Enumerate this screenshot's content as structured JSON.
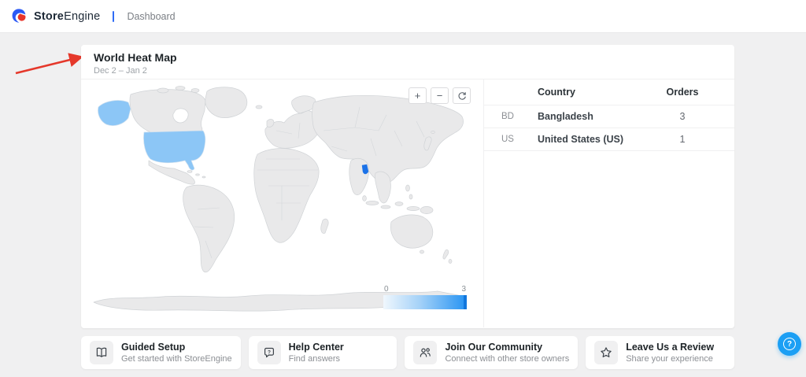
{
  "header": {
    "brand_bold": "Store",
    "brand_light": "Engine",
    "nav": "Dashboard"
  },
  "heatmap": {
    "title": "World Heat Map",
    "date_range": "Dec 2 – Jan 2",
    "controls": {
      "zoom_in": "+",
      "zoom_out": "−"
    },
    "legend": {
      "min": "0",
      "max": "3"
    },
    "table": {
      "header": {
        "country": "Country",
        "orders": "Orders"
      },
      "rows": [
        {
          "code": "BD",
          "country": "Bangladesh",
          "orders": "3"
        },
        {
          "code": "US",
          "country": "United States (US)",
          "orders": "1"
        }
      ]
    }
  },
  "chart_data": {
    "type": "heatmap",
    "title": "World Heat Map",
    "subtitle": "Dec 2 – Jan 2",
    "metric": "Orders",
    "points": [
      {
        "code": "BD",
        "name": "Bangladesh",
        "value": 3
      },
      {
        "code": "US",
        "name": "United States (US)",
        "value": 1
      }
    ],
    "scale": {
      "min": 0,
      "max": 3,
      "low_color": "#8cc6f6",
      "high_color": "#1b72e8"
    },
    "legend_position": "bottom-right"
  },
  "cards": [
    {
      "title": "Guided Setup",
      "subtitle": "Get started with StoreEngine",
      "icon": "book-icon"
    },
    {
      "title": "Help Center",
      "subtitle": "Find answers",
      "icon": "chat-question-icon"
    },
    {
      "title": "Join Our Community",
      "subtitle": "Connect with other store owners",
      "icon": "people-icon"
    },
    {
      "title": "Leave Us a Review",
      "subtitle": "Share your experience",
      "icon": "star-icon"
    }
  ],
  "floating_help": {
    "glyph": "?"
  },
  "colors": {
    "page_bg": "#f0f0f1",
    "accent_blue": "#1b9ff4",
    "brand_blue": "#2b59f5",
    "brand_red": "#e8352a",
    "map_land": "#e9e9ea",
    "map_low": "#8cc6f6",
    "map_high": "#1b72e8",
    "arrow_red": "#e5382b"
  }
}
